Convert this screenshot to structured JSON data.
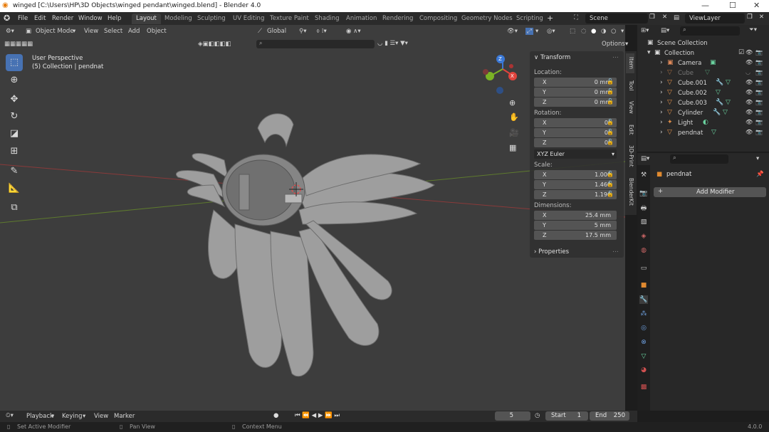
{
  "window": {
    "title": "winged [C:\\Users\\HP\\3D Objects\\winged pendant\\winged.blend] - Blender 4.0"
  },
  "menu": [
    "File",
    "Edit",
    "Render",
    "Window",
    "Help"
  ],
  "workspaces": [
    "Layout",
    "Modeling",
    "Sculpting",
    "UV Editing",
    "Texture Paint",
    "Shading",
    "Animation",
    "Rendering",
    "Compositing",
    "Geometry Nodes",
    "Scripting"
  ],
  "scene": "Scene",
  "view_layer": "ViewLayer",
  "viewport": {
    "mode": "Object Mode",
    "menus": [
      "View",
      "Select",
      "Add",
      "Object"
    ],
    "orientation": "Global",
    "options": "Options",
    "perspective": "User Perspective",
    "context": "(5) Collection | pendnat"
  },
  "gizmo": {
    "z": "Z",
    "x": "X",
    "y": "Y"
  },
  "npanel": {
    "transform": "Transform",
    "location": "Location:",
    "loc": [
      "0 mm",
      "0 mm",
      "0 mm"
    ],
    "rotation": "Rotation:",
    "rot": [
      "0°",
      "0°",
      "0°"
    ],
    "rot_mode": "XYZ Euler",
    "scale": "Scale:",
    "scl": [
      "1.000",
      "1.460",
      "1.196"
    ],
    "dimensions": "Dimensions:",
    "dim": [
      "25.4 mm",
      "5 mm",
      "17.5 mm"
    ],
    "properties": "Properties",
    "axes": [
      "X",
      "Y",
      "Z"
    ],
    "tabs": [
      "Item",
      "Tool",
      "View",
      "Edit",
      "3D-Print",
      "BlenderKit"
    ]
  },
  "outliner": {
    "root": "Scene Collection",
    "collection": "Collection",
    "items": [
      "Camera",
      "Cube",
      "Cube.001",
      "Cube.002",
      "Cube.003",
      "Cylinder",
      "Light",
      "pendnat"
    ]
  },
  "properties": {
    "object": "pendnat",
    "add_modifier": "Add Modifier"
  },
  "timeline": {
    "menus": [
      "Playback",
      "Keying",
      "View",
      "Marker"
    ],
    "frame": "5",
    "start_label": "Start",
    "start": "1",
    "end_label": "End",
    "end": "250"
  },
  "status": {
    "left": "Set Active Modifier",
    "mid": "Pan View",
    "right": "Context Menu",
    "version": "4.0.0"
  },
  "colors": {
    "accent": "#4772b3",
    "bg": "#3d3d3d",
    "x_axis": "#e0443d",
    "y_axis": "#7bb325",
    "z_axis": "#3a78d6"
  }
}
